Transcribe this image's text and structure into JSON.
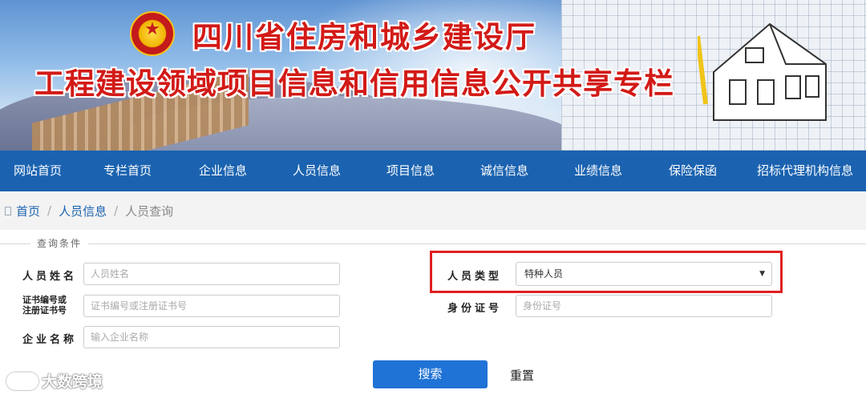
{
  "banner": {
    "title_line1": "四川省住房和城乡建设厅",
    "title_line2": "工程建设领域项目信息和信用信息公开共享专栏"
  },
  "nav": {
    "items": [
      "网站首页",
      "专栏首页",
      "企业信息",
      "人员信息",
      "项目信息",
      "诚信信息",
      "业绩信息",
      "保险保函",
      "招标代理机构信息"
    ]
  },
  "breadcrumb": {
    "home": "首页",
    "section": "人员信息",
    "current": "人员查询",
    "separator": "/"
  },
  "form": {
    "legend": "查询条件",
    "name_label": "人员姓名",
    "name_placeholder": "人员姓名",
    "cert_label_line1": "证书编号或",
    "cert_label_line2": "注册证书号",
    "cert_placeholder": "证书编号或注册证书号",
    "company_label": "企业名称",
    "company_placeholder": "输入企业名称",
    "type_label": "人员类型",
    "type_selected": "特种人员",
    "id_label": "身份证号",
    "id_placeholder": "身份证号",
    "search_label": "搜索",
    "reset_label": "重置"
  },
  "watermark": {
    "text": "大数跨境"
  },
  "colors": {
    "nav_bg": "#1b63b0",
    "title_red": "#d21a17",
    "button_blue": "#1f72d6",
    "highlight_red": "#e02020"
  }
}
